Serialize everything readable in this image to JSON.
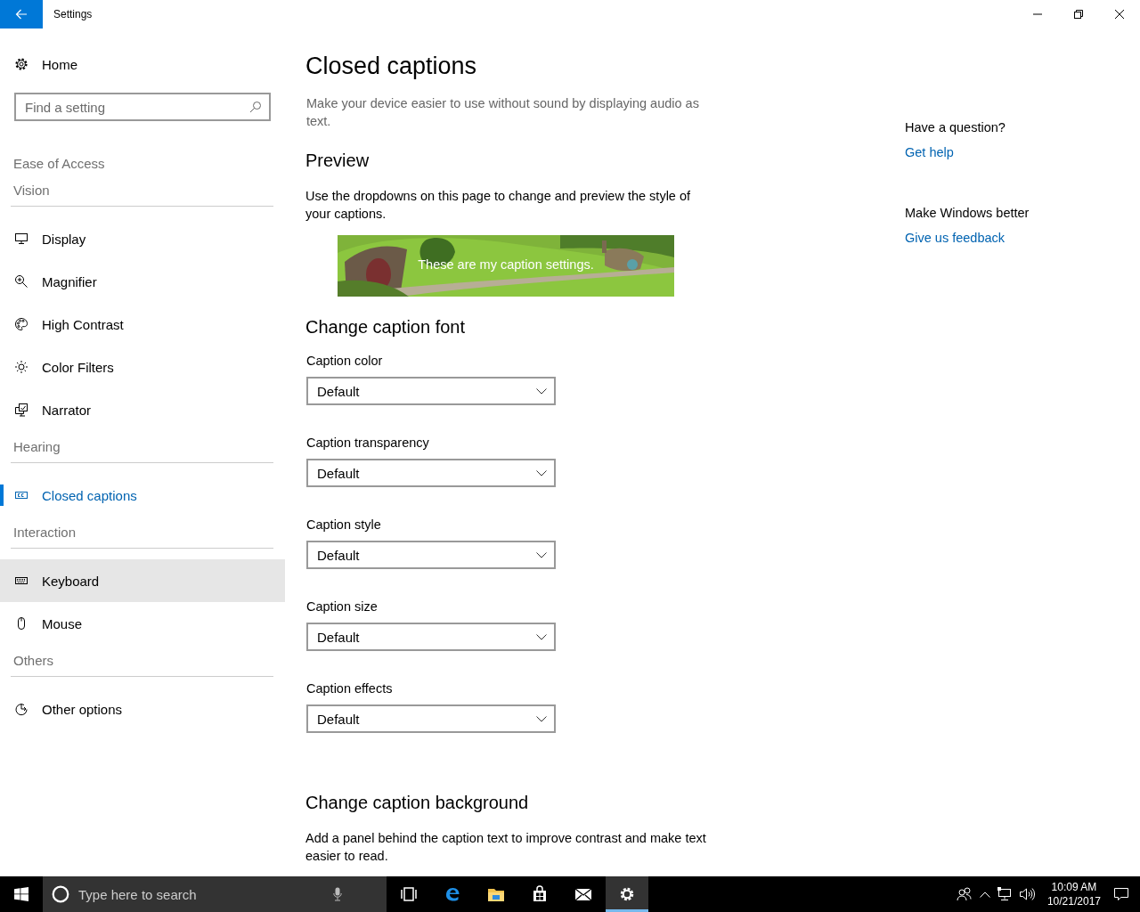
{
  "window": {
    "title": "Settings"
  },
  "sidebar": {
    "home": "Home",
    "search": {
      "placeholder": "Find a setting"
    },
    "items": [
      {
        "kind": "title",
        "label": "Ease of Access"
      },
      {
        "kind": "group",
        "label": "Vision"
      },
      {
        "kind": "nav",
        "label": "Display",
        "selected": false,
        "hovered": false
      },
      {
        "kind": "nav",
        "label": "Magnifier",
        "selected": false,
        "hovered": false
      },
      {
        "kind": "nav",
        "label": "High Contrast",
        "selected": false,
        "hovered": false
      },
      {
        "kind": "nav",
        "label": "Color Filters",
        "selected": false,
        "hovered": false
      },
      {
        "kind": "nav",
        "label": "Narrator",
        "selected": false,
        "hovered": false
      },
      {
        "kind": "group",
        "label": "Hearing"
      },
      {
        "kind": "nav",
        "label": "Closed captions",
        "selected": true,
        "hovered": false
      },
      {
        "kind": "group",
        "label": "Interaction"
      },
      {
        "kind": "nav",
        "label": "Keyboard",
        "selected": false,
        "hovered": true
      },
      {
        "kind": "nav",
        "label": "Mouse",
        "selected": false,
        "hovered": false
      },
      {
        "kind": "group",
        "label": "Others"
      },
      {
        "kind": "nav",
        "label": "Other options",
        "selected": false,
        "hovered": false
      }
    ]
  },
  "content": {
    "title": "Closed captions",
    "description": "Make your device easier to use without sound by displaying audio as text.",
    "preview": {
      "heading": "Preview",
      "text": "Use the dropdowns on this page to change and preview the style of your captions.",
      "caption": "These are my caption settings."
    },
    "font": {
      "heading": "Change caption font",
      "dropdowns": [
        {
          "label": "Caption color",
          "value": "Default"
        },
        {
          "label": "Caption transparency",
          "value": "Default"
        },
        {
          "label": "Caption style",
          "value": "Default"
        },
        {
          "label": "Caption size",
          "value": "Default"
        },
        {
          "label": "Caption effects",
          "value": "Default"
        }
      ]
    },
    "background": {
      "heading": "Change caption background",
      "text": "Add a panel behind the caption text to improve contrast and make text easier to read."
    }
  },
  "aside": [
    {
      "heading": "Have a question?",
      "link": "Get help"
    },
    {
      "heading": "Make Windows better",
      "link": "Give us feedback"
    }
  ],
  "taskbar": {
    "search": {
      "placeholder": "Type here to search"
    },
    "apps": [
      {
        "selected": false
      },
      {
        "selected": false
      },
      {
        "selected": false
      },
      {
        "selected": false
      },
      {
        "selected": false
      },
      {
        "selected": true
      }
    ],
    "time": "10:09 AM",
    "date": "10/21/2017"
  }
}
